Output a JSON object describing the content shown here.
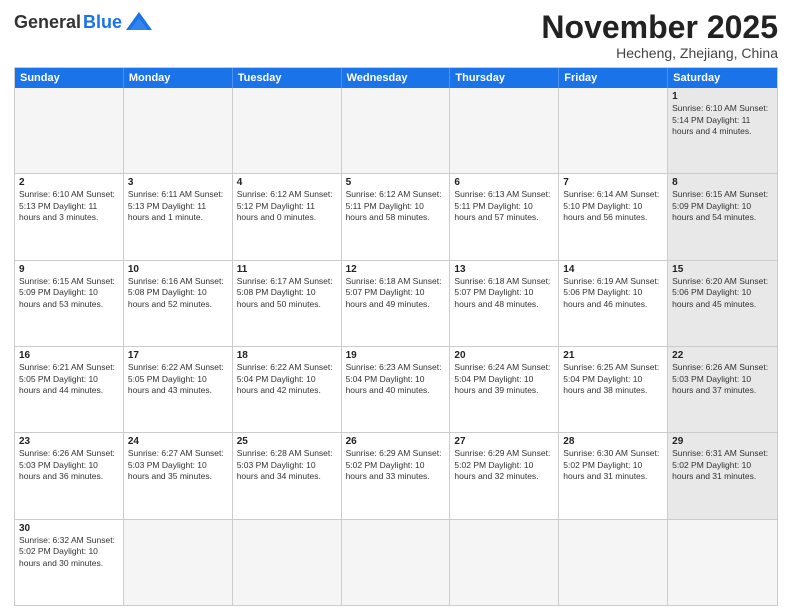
{
  "header": {
    "logo_general": "General",
    "logo_blue": "Blue",
    "month_title": "November 2025",
    "subtitle": "Hecheng, Zhejiang, China"
  },
  "days_of_week": [
    "Sunday",
    "Monday",
    "Tuesday",
    "Wednesday",
    "Thursday",
    "Friday",
    "Saturday"
  ],
  "weeks": [
    [
      {
        "day": "",
        "info": "",
        "empty": true
      },
      {
        "day": "",
        "info": "",
        "empty": true
      },
      {
        "day": "",
        "info": "",
        "empty": true
      },
      {
        "day": "",
        "info": "",
        "empty": true
      },
      {
        "day": "",
        "info": "",
        "empty": true
      },
      {
        "day": "",
        "info": "",
        "empty": true
      },
      {
        "day": "1",
        "info": "Sunrise: 6:10 AM\nSunset: 5:14 PM\nDaylight: 11 hours\nand 4 minutes.",
        "shaded": true
      }
    ],
    [
      {
        "day": "2",
        "info": "Sunrise: 6:10 AM\nSunset: 5:13 PM\nDaylight: 11 hours\nand 3 minutes."
      },
      {
        "day": "3",
        "info": "Sunrise: 6:11 AM\nSunset: 5:13 PM\nDaylight: 11 hours\nand 1 minute."
      },
      {
        "day": "4",
        "info": "Sunrise: 6:12 AM\nSunset: 5:12 PM\nDaylight: 11 hours\nand 0 minutes."
      },
      {
        "day": "5",
        "info": "Sunrise: 6:12 AM\nSunset: 5:11 PM\nDaylight: 10 hours\nand 58 minutes."
      },
      {
        "day": "6",
        "info": "Sunrise: 6:13 AM\nSunset: 5:11 PM\nDaylight: 10 hours\nand 57 minutes."
      },
      {
        "day": "7",
        "info": "Sunrise: 6:14 AM\nSunset: 5:10 PM\nDaylight: 10 hours\nand 56 minutes."
      },
      {
        "day": "8",
        "info": "Sunrise: 6:15 AM\nSunset: 5:09 PM\nDaylight: 10 hours\nand 54 minutes.",
        "shaded": true
      }
    ],
    [
      {
        "day": "9",
        "info": "Sunrise: 6:15 AM\nSunset: 5:09 PM\nDaylight: 10 hours\nand 53 minutes."
      },
      {
        "day": "10",
        "info": "Sunrise: 6:16 AM\nSunset: 5:08 PM\nDaylight: 10 hours\nand 52 minutes."
      },
      {
        "day": "11",
        "info": "Sunrise: 6:17 AM\nSunset: 5:08 PM\nDaylight: 10 hours\nand 50 minutes."
      },
      {
        "day": "12",
        "info": "Sunrise: 6:18 AM\nSunset: 5:07 PM\nDaylight: 10 hours\nand 49 minutes."
      },
      {
        "day": "13",
        "info": "Sunrise: 6:18 AM\nSunset: 5:07 PM\nDaylight: 10 hours\nand 48 minutes."
      },
      {
        "day": "14",
        "info": "Sunrise: 6:19 AM\nSunset: 5:06 PM\nDaylight: 10 hours\nand 46 minutes."
      },
      {
        "day": "15",
        "info": "Sunrise: 6:20 AM\nSunset: 5:06 PM\nDaylight: 10 hours\nand 45 minutes.",
        "shaded": true
      }
    ],
    [
      {
        "day": "16",
        "info": "Sunrise: 6:21 AM\nSunset: 5:05 PM\nDaylight: 10 hours\nand 44 minutes."
      },
      {
        "day": "17",
        "info": "Sunrise: 6:22 AM\nSunset: 5:05 PM\nDaylight: 10 hours\nand 43 minutes."
      },
      {
        "day": "18",
        "info": "Sunrise: 6:22 AM\nSunset: 5:04 PM\nDaylight: 10 hours\nand 42 minutes."
      },
      {
        "day": "19",
        "info": "Sunrise: 6:23 AM\nSunset: 5:04 PM\nDaylight: 10 hours\nand 40 minutes."
      },
      {
        "day": "20",
        "info": "Sunrise: 6:24 AM\nSunset: 5:04 PM\nDaylight: 10 hours\nand 39 minutes."
      },
      {
        "day": "21",
        "info": "Sunrise: 6:25 AM\nSunset: 5:04 PM\nDaylight: 10 hours\nand 38 minutes."
      },
      {
        "day": "22",
        "info": "Sunrise: 6:26 AM\nSunset: 5:03 PM\nDaylight: 10 hours\nand 37 minutes.",
        "shaded": true
      }
    ],
    [
      {
        "day": "23",
        "info": "Sunrise: 6:26 AM\nSunset: 5:03 PM\nDaylight: 10 hours\nand 36 minutes."
      },
      {
        "day": "24",
        "info": "Sunrise: 6:27 AM\nSunset: 5:03 PM\nDaylight: 10 hours\nand 35 minutes."
      },
      {
        "day": "25",
        "info": "Sunrise: 6:28 AM\nSunset: 5:03 PM\nDaylight: 10 hours\nand 34 minutes."
      },
      {
        "day": "26",
        "info": "Sunrise: 6:29 AM\nSunset: 5:02 PM\nDaylight: 10 hours\nand 33 minutes."
      },
      {
        "day": "27",
        "info": "Sunrise: 6:29 AM\nSunset: 5:02 PM\nDaylight: 10 hours\nand 32 minutes."
      },
      {
        "day": "28",
        "info": "Sunrise: 6:30 AM\nSunset: 5:02 PM\nDaylight: 10 hours\nand 31 minutes."
      },
      {
        "day": "29",
        "info": "Sunrise: 6:31 AM\nSunset: 5:02 PM\nDaylight: 10 hours\nand 31 minutes.",
        "shaded": true
      }
    ],
    [
      {
        "day": "30",
        "info": "Sunrise: 6:32 AM\nSunset: 5:02 PM\nDaylight: 10 hours\nand 30 minutes."
      },
      {
        "day": "",
        "info": "",
        "empty": true
      },
      {
        "day": "",
        "info": "",
        "empty": true
      },
      {
        "day": "",
        "info": "",
        "empty": true
      },
      {
        "day": "",
        "info": "",
        "empty": true
      },
      {
        "day": "",
        "info": "",
        "empty": true
      },
      {
        "day": "",
        "info": "",
        "empty": true
      }
    ]
  ]
}
